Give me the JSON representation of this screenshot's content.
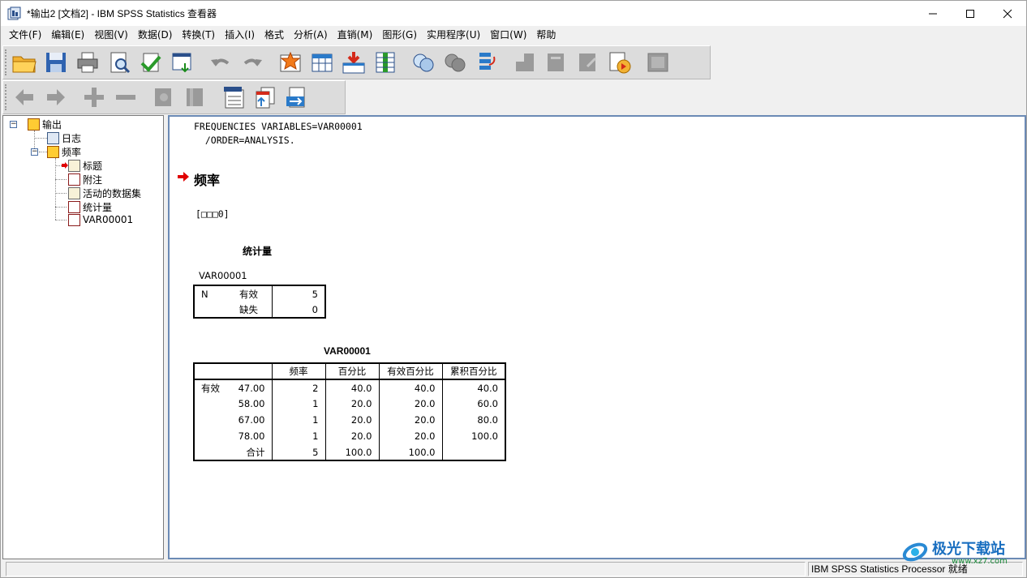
{
  "window": {
    "title": "*输出2 [文档2] - IBM SPSS Statistics 查看器"
  },
  "menu": [
    "文件(F)",
    "编辑(E)",
    "视图(V)",
    "数据(D)",
    "转换(T)",
    "插入(I)",
    "格式",
    "分析(A)",
    "直销(M)",
    "图形(G)",
    "实用程序(U)",
    "窗口(W)",
    "帮助"
  ],
  "toolbar1_icons": [
    "open-icon",
    "save-icon",
    "print-icon",
    "print-preview-icon",
    "export-icon",
    "recall-dialog-icon",
    "undo-icon",
    "redo-icon",
    "goto-case-icon",
    "goto-variable-icon",
    "insert-cases-icon",
    "variables-icon",
    "use-sets-icon",
    "show-all-icon",
    "designate-window-icon",
    "select-last-output-icon",
    "insert-heading-icon",
    "insert-text-icon",
    "script-icon",
    "gray-box-icon"
  ],
  "toolbar2_icons": [
    "promote-icon",
    "demote-icon",
    "expand-icon",
    "collapse-icon",
    "show-icon",
    "hide-icon",
    "insert-title-icon",
    "insert-new-icon",
    "insert-export-icon"
  ],
  "outline": {
    "root": "输出",
    "log": "日志",
    "freq": "频率",
    "children": [
      "标题",
      "附注",
      "活动的数据集",
      "统计量",
      "VAR00001"
    ]
  },
  "output": {
    "syntax_line1": "FREQUENCIES VARIABLES=VAR00001",
    "syntax_line2": "  /ORDER=ANALYSIS.",
    "heading": "频率",
    "dataset": "[□□□0]",
    "stats_title": "统计量",
    "stats_var": "VAR00001",
    "stats_rows": [
      {
        "c1": "N",
        "c2": "有效",
        "v": "5"
      },
      {
        "c1": "",
        "c2": "缺失",
        "v": "0"
      }
    ],
    "freq_title": "VAR00001",
    "freq_headers": [
      "频率",
      "百分比",
      "有效百分比",
      "累积百分比"
    ],
    "freq_rows": [
      {
        "g": "有效",
        "v": "47.00",
        "f": "2",
        "p": "40.0",
        "vp": "40.0",
        "cp": "40.0"
      },
      {
        "g": "",
        "v": "58.00",
        "f": "1",
        "p": "20.0",
        "vp": "20.0",
        "cp": "60.0"
      },
      {
        "g": "",
        "v": "67.00",
        "f": "1",
        "p": "20.0",
        "vp": "20.0",
        "cp": "80.0"
      },
      {
        "g": "",
        "v": "78.00",
        "f": "1",
        "p": "20.0",
        "vp": "20.0",
        "cp": "100.0"
      },
      {
        "g": "",
        "v": "合计",
        "f": "5",
        "p": "100.0",
        "vp": "100.0",
        "cp": ""
      }
    ]
  },
  "status": {
    "right": "IBM SPSS Statistics Processor 就绪"
  },
  "watermark": {
    "text": "极光下载站",
    "url": "www.xz7.com"
  }
}
